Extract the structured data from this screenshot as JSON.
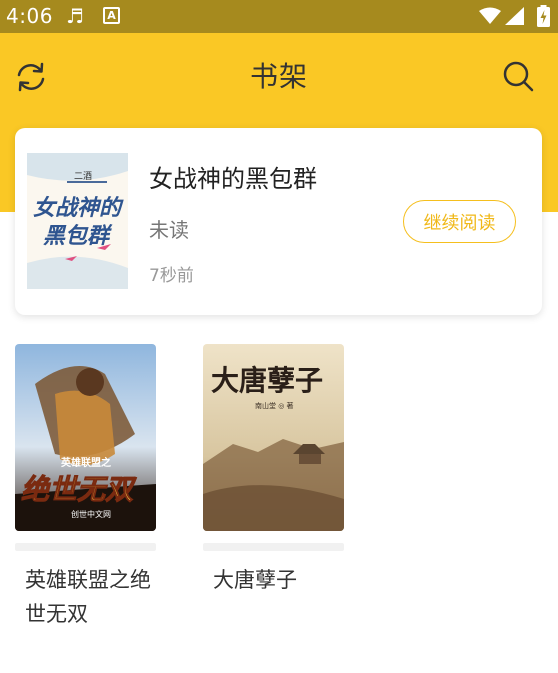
{
  "status_bar": {
    "time": "4:06",
    "icons": [
      "music-note-icon",
      "a-notification-icon",
      "wifi-icon",
      "cell-signal-icon",
      "battery-charging-icon"
    ]
  },
  "header": {
    "title": "书架",
    "left_icon": "refresh-icon",
    "right_icon": "search-icon",
    "background_color": "#fac825"
  },
  "recent_book": {
    "title": "女战神的黑包群",
    "status": "未读",
    "time_ago": "7秒前",
    "continue_label": "继续阅读",
    "cover_text": {
      "line1": "女战神的",
      "line2": "黑包群",
      "small": "二酒"
    },
    "accent_color": "#f0b818"
  },
  "books": [
    {
      "name": "英雄联盟之绝世无双",
      "cover_text": {
        "title": "绝世无双",
        "subtitle": "英雄联盟之",
        "publisher": "创世中文网"
      }
    },
    {
      "name": "大唐孽子",
      "cover_text": {
        "title": "大唐孽子",
        "author": "南山堂 ◎ 著"
      }
    }
  ]
}
